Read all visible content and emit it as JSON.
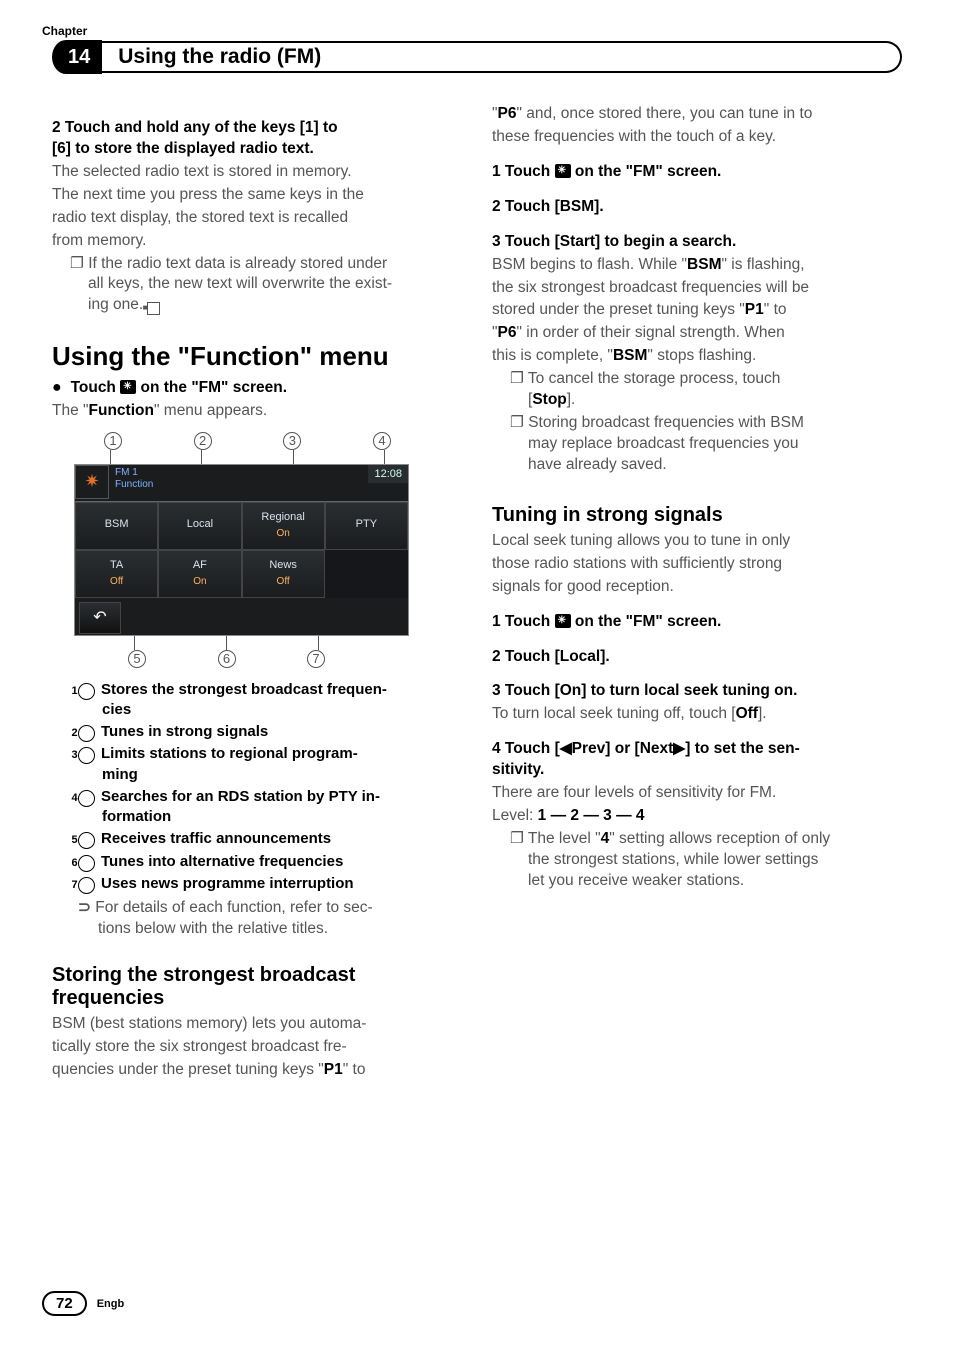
{
  "header": {
    "chapter_label": "Chapter",
    "chapter_number": "14",
    "title": "Using the radio (FM)"
  },
  "left": {
    "step2_heading_a": "2    Touch and hold any of the keys [1] to",
    "step2_heading_b": "[6] to store the displayed radio text.",
    "step2_body_1": "The selected radio text is stored in memory.",
    "step2_body_2": "The next time you press the same keys in the",
    "step2_body_3": "radio text display, the stored text is recalled",
    "step2_body_4": "from memory.",
    "step2_note_1": "If the radio text data is already stored under",
    "step2_note_2": "all keys, the new text will overwrite the exist-",
    "step2_note_3": "ing one.",
    "func_heading": "Using the \"Function\" menu",
    "func_bullet_a": "Touch ",
    "func_bullet_b": " on the \"FM\" screen.",
    "func_sub": "The \"",
    "func_sub_bold": "Function",
    "func_sub_tail": "\" menu appears.",
    "screen": {
      "title_line1": "FM 1",
      "title_line2": "Function",
      "clock": "12:08",
      "cells": [
        {
          "label": "BSM",
          "sub": ""
        },
        {
          "label": "Local",
          "sub": ""
        },
        {
          "label": "Regional",
          "sub": "On"
        },
        {
          "label": "PTY",
          "sub": ""
        },
        {
          "label": "TA",
          "sub": "Off"
        },
        {
          "label": "AF",
          "sub": "On"
        },
        {
          "label": "News",
          "sub": "Off"
        },
        {
          "label": "",
          "sub": ""
        }
      ],
      "back": "↶"
    },
    "func_items": [
      "Stores the strongest broadcast frequen-",
      "cies",
      "Tunes in strong signals",
      "Limits stations to regional program-",
      "ming",
      "Searches for an RDS station by PTY in-",
      "formation",
      "Receives traffic announcements",
      "Tunes into alternative frequencies",
      "Uses news programme interruption"
    ],
    "xref_1": "For details of each function, refer to sec-",
    "xref_2": "tions below with the relative titles.",
    "bsm_heading_1": "Storing the strongest broadcast",
    "bsm_heading_2": "frequencies",
    "bsm_body_1": "BSM (best stations memory) lets you automa-",
    "bsm_body_2": "tically store the six strongest broadcast fre-",
    "bsm_body_3": "quencies under the preset tuning keys \"",
    "bsm_body_3_bold": "P1",
    "bsm_body_3_tail": "\" to"
  },
  "right": {
    "p6_line_1a": "\"",
    "p6_line_1_bold": "P6",
    "p6_line_1b": "\" and, once stored there, you can tune in to",
    "p6_line_2": "these frequencies with the touch of a key.",
    "r_step1_a": "1    Touch ",
    "r_step1_b": " on the \"FM\" screen.",
    "r_step2": "2    Touch [BSM].",
    "r_step3": "3    Touch [Start] to begin a search.",
    "r_body_1a": "BSM begins to flash. While \"",
    "r_body_1_bold": "BSM",
    "r_body_1b": "\" is flashing,",
    "r_body_2": "the six strongest broadcast frequencies will be",
    "r_body_3a": "stored under the preset tuning keys \"",
    "r_body_3_bold": "P1",
    "r_body_3b": "\" to",
    "r_body_4a": "\"",
    "r_body_4_bold": "P6",
    "r_body_4b": "\" in order of their signal strength. When",
    "r_body_5a": "this is complete, \"",
    "r_body_5_bold": "BSM",
    "r_body_5b": "\" stops flashing.",
    "r_note1_1": "To cancel the storage process, touch",
    "r_note1_2a": "[",
    "r_note1_2_bold": "Stop",
    "r_note1_2b": "].",
    "r_note2_1": "Storing broadcast frequencies with BSM",
    "r_note2_2": "may replace broadcast frequencies you",
    "r_note2_3": "have already saved.",
    "tun_heading": "Tuning in strong signals",
    "tun_body_1": "Local seek tuning allows you to tune in only",
    "tun_body_2": "those radio stations with sufficiently strong",
    "tun_body_3": "signals for good reception.",
    "t_step1_a": "1    Touch ",
    "t_step1_b": " on the \"FM\" screen.",
    "t_step2": "2    Touch [Local].",
    "t_step3": "3    Touch [On] to turn local seek tuning on.",
    "t_step3_body_a": "To turn local seek tuning off, touch [",
    "t_step3_body_bold": "Off",
    "t_step3_body_b": "].",
    "t_step4_a": "4    Touch [◀Prev] or [Next▶] to set the sen-",
    "t_step4_b": "sitivity.",
    "t_body_4": "There are four levels of sensitivity for FM.",
    "t_level_a": "Level: ",
    "t_level_b": "1 — 2 — 3 — 4",
    "t_note_1a": "The level \"",
    "t_note_1_bold": "4",
    "t_note_1b": "\" setting allows reception of only",
    "t_note_2": "the strongest stations, while lower settings",
    "t_note_3": "let you receive weaker stations."
  },
  "footer": {
    "page": "72",
    "lang": "Engb"
  }
}
